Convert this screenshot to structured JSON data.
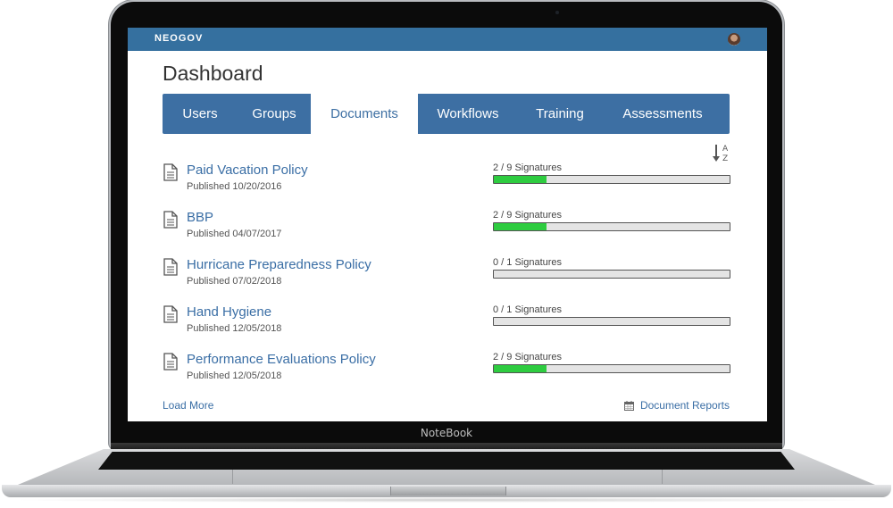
{
  "device": {
    "label": "NoteBook"
  },
  "app": {
    "brand": "NEOGOV",
    "accent_color": "#35709f",
    "progress_color": "#2ecc40"
  },
  "page": {
    "title": "Dashboard"
  },
  "tabs": [
    {
      "label": "Users",
      "active": false
    },
    {
      "label": "Groups",
      "active": false
    },
    {
      "label": "Documents",
      "active": true
    },
    {
      "label": "Workflows",
      "active": false
    },
    {
      "label": "Training",
      "active": false
    },
    {
      "label": "Assessments",
      "active": false
    }
  ],
  "sort": {
    "icon": "sort-alpha-down-icon"
  },
  "documents": [
    {
      "title": "Paid Vacation Policy",
      "published": "Published 10/20/2016",
      "signatures": "2 / 9 Signatures",
      "signed": 2,
      "total": 9
    },
    {
      "title": "BBP",
      "published": "Published 04/07/2017",
      "signatures": "2 / 9 Signatures",
      "signed": 2,
      "total": 9
    },
    {
      "title": "Hurricane Preparedness Policy",
      "published": "Published 07/02/2018",
      "signatures": "0 / 1 Signatures",
      "signed": 0,
      "total": 1
    },
    {
      "title": "Hand Hygiene",
      "published": "Published 12/05/2018",
      "signatures": "0 / 1 Signatures",
      "signed": 0,
      "total": 1
    },
    {
      "title": "Performance Evaluations Policy",
      "published": "Published 12/05/2018",
      "signatures": "2 / 9 Signatures",
      "signed": 2,
      "total": 9
    }
  ],
  "footer": {
    "load_more": "Load More",
    "reports": "Document Reports",
    "reports_icon": "calendar-icon"
  }
}
